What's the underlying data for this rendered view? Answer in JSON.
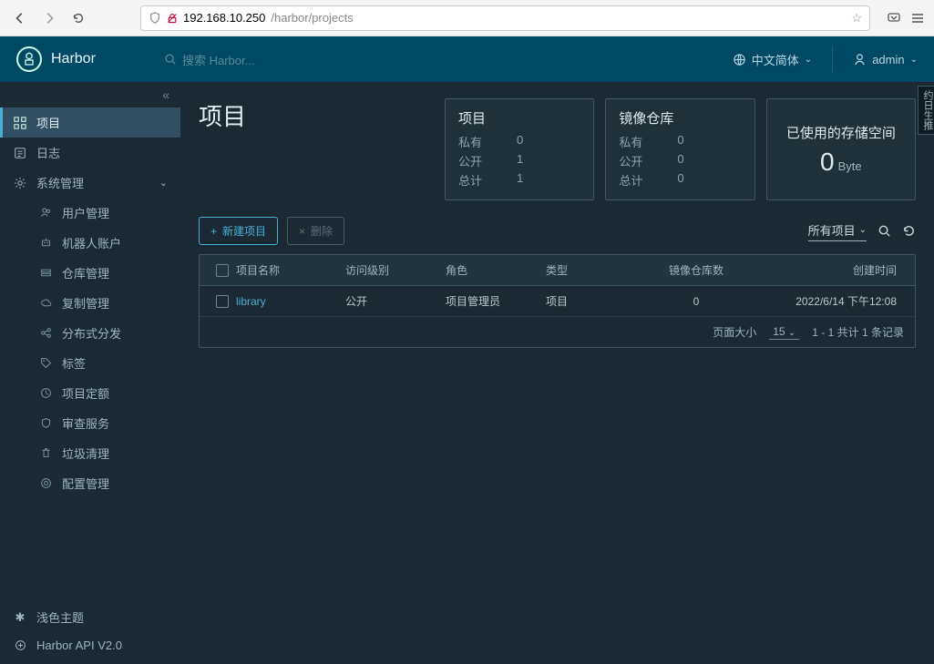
{
  "browser": {
    "host": "192.168.10.250",
    "path": "/harbor/projects"
  },
  "header": {
    "app_name": "Harbor",
    "search_placeholder": "搜索 Harbor...",
    "language": "中文简体",
    "user": "admin"
  },
  "sidebar": {
    "items": {
      "projects": "项目",
      "logs": "日志",
      "admin": "系统管理"
    },
    "admin_sub": [
      "用户管理",
      "机器人账户",
      "仓库管理",
      "复制管理",
      "分布式分发",
      "标签",
      "项目定额",
      "审查服务",
      "垃圾清理",
      "配置管理"
    ],
    "bottom": {
      "theme": "浅色主题",
      "api": "Harbor API V2.0"
    },
    "right_tab": "约日生推"
  },
  "page": {
    "title": "项目"
  },
  "cards": {
    "projects": {
      "title": "项目",
      "rows": [
        {
          "k": "私有",
          "v": "0"
        },
        {
          "k": "公开",
          "v": "1"
        },
        {
          "k": "总计",
          "v": "1"
        }
      ]
    },
    "repos": {
      "title": "镜像仓库",
      "rows": [
        {
          "k": "私有",
          "v": "0"
        },
        {
          "k": "公开",
          "v": "0"
        },
        {
          "k": "总计",
          "v": "0"
        }
      ]
    },
    "storage": {
      "title": "已使用的存储空间",
      "value": "0",
      "unit": "Byte"
    }
  },
  "actions": {
    "new_project": "新建项目",
    "delete": "删除",
    "filter": "所有项目"
  },
  "table": {
    "headers": {
      "name": "项目名称",
      "access": "访问级别",
      "role": "角色",
      "type": "类型",
      "repo_count": "镜像仓库数",
      "created": "创建时间"
    },
    "rows": [
      {
        "name": "library",
        "access": "公开",
        "role": "项目管理员",
        "type": "项目",
        "repo_count": "0",
        "created": "2022/6/14 下午12:08"
      }
    ],
    "footer": {
      "page_size_label": "页面大小",
      "page_size": "15",
      "summary": "1 - 1 共计 1 条记录"
    }
  }
}
